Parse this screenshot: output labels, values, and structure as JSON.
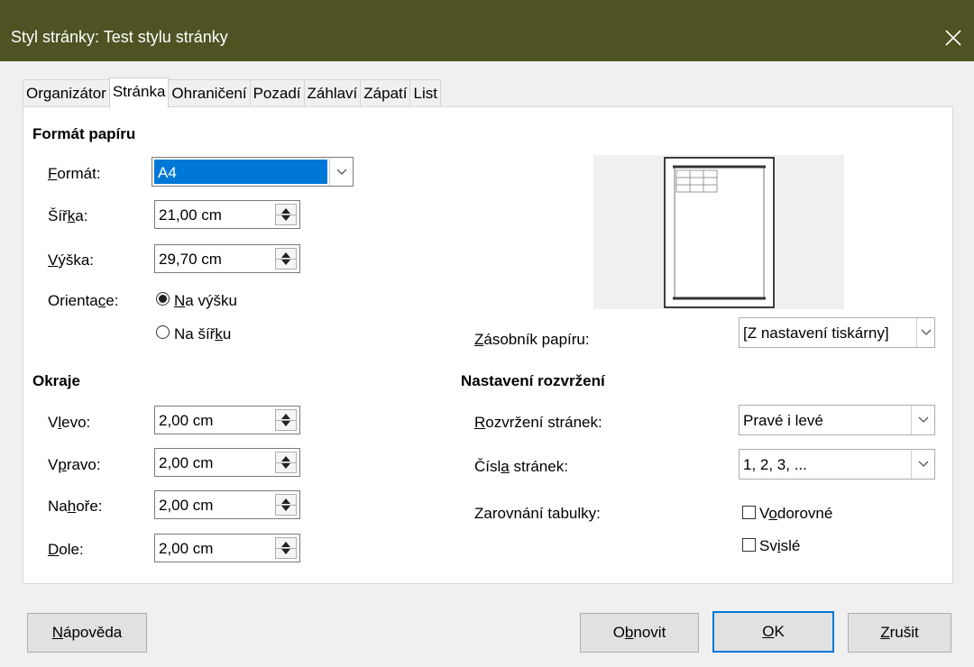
{
  "window": {
    "title": "Styl stránky: Test stylu stránky",
    "close_icon": "close-icon"
  },
  "tabs": [
    "Organizátor",
    "Stránka",
    "Ohraničení",
    "Pozadí",
    "Záhlaví",
    "Zápatí",
    "List"
  ],
  "active_tab": "Stránka",
  "paper_format": {
    "heading": "Formát papíru",
    "format_label": "Formát:",
    "format_value": "A4",
    "width_label": "Šířka:",
    "width_value": "21,00 cm",
    "height_label": "Výška:",
    "height_value": "29,70 cm",
    "orientation_label": "Orientace:",
    "portrait_label": "Na výšku",
    "landscape_label": "Na šířku",
    "selected_orientation": "Na výšku"
  },
  "margins": {
    "heading": "Okraje",
    "left_label": "Vlevo:",
    "left_value": "2,00 cm",
    "right_label": "Vpravo:",
    "right_value": "2,00 cm",
    "top_label": "Nahoře:",
    "top_value": "2,00 cm",
    "bottom_label": "Dole:",
    "bottom_value": "2,00 cm"
  },
  "paper_tray": {
    "label": "Zásobník papíru:",
    "value": "[Z nastavení tiskárny]"
  },
  "layout": {
    "heading": "Nastavení rozvržení",
    "page_layout_label": "Rozvržení stránek:",
    "page_layout_value": "Pravé i levé",
    "page_numbers_label": "Čísla stránek:",
    "page_numbers_value": "1, 2, 3, ...",
    "table_alignment_label": "Zarovnání tabulky:",
    "horizontal_label": "Vodorovné",
    "vertical_label": "Svislé",
    "horizontal_checked": false,
    "vertical_checked": false
  },
  "buttons": {
    "help": "Nápověda",
    "reset": "Obnovit",
    "ok": "OK",
    "cancel": "Zrušit"
  },
  "colors": {
    "titlebar": "#4f5324",
    "selection": "#0078d7",
    "dialog_bg": "#f0f0f0"
  }
}
